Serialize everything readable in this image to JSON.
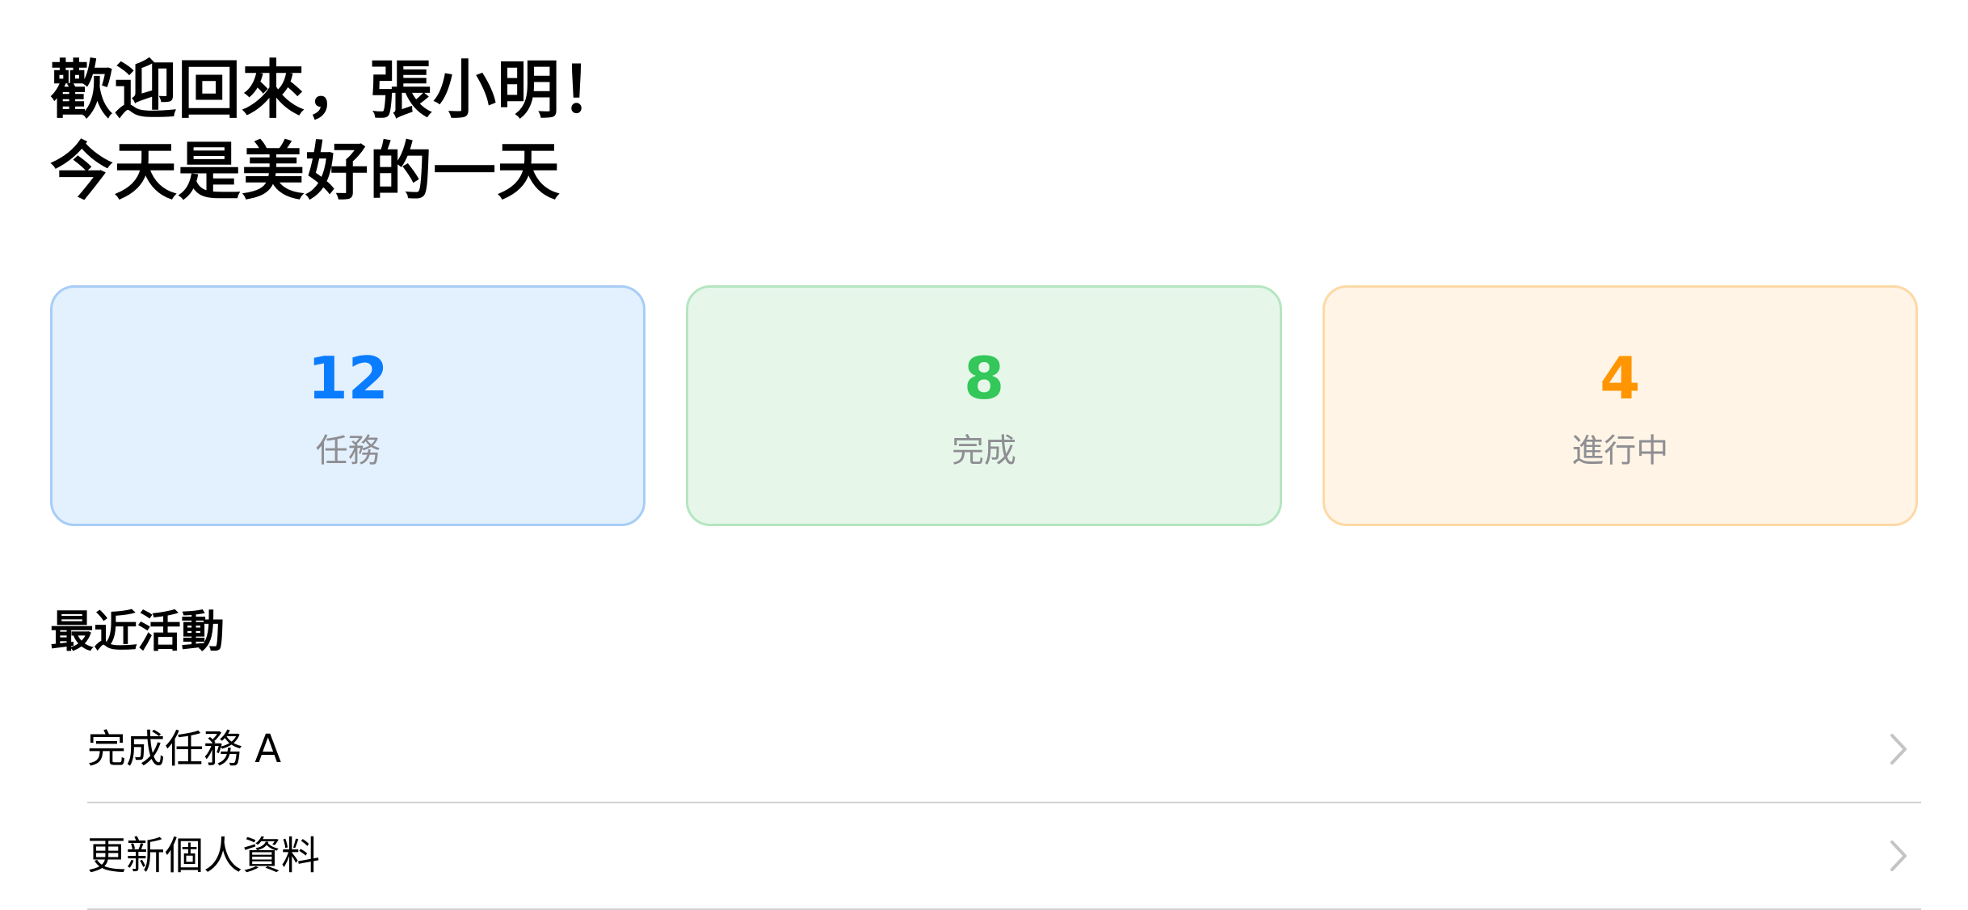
{
  "greeting": {
    "line1": "歡迎回來，張小明！",
    "line2": "今天是美好的一天"
  },
  "stats": [
    {
      "value": "12",
      "label": "任務",
      "color": "#0a7cff",
      "bg": "#e3f0fd",
      "border": "#a7cdf7"
    },
    {
      "value": "8",
      "label": "完成",
      "color": "#34c759",
      "bg": "#e6f7ea",
      "border": "#b4e6c0"
    },
    {
      "value": "4",
      "label": "進行中",
      "color": "#ff9500",
      "bg": "#fff4e5",
      "border": "#fdd9a6"
    }
  ],
  "recent": {
    "title": "最近活動",
    "items": [
      {
        "label": "完成任務 A",
        "icon": "chevron-right-icon"
      },
      {
        "label": "更新個人資料",
        "icon": "chevron-right-icon"
      }
    ]
  },
  "colors": {
    "text": "#000000",
    "secondary_text": "#8e8e93",
    "separator": "#d1d1d6",
    "chevron": "#c4c4c7"
  }
}
